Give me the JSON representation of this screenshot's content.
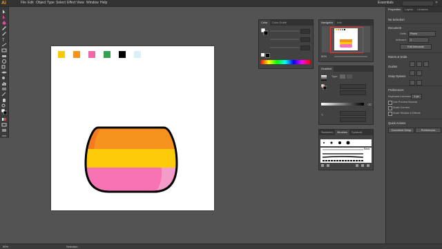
{
  "app": {
    "logo": "Ai"
  },
  "menu": [
    "File",
    "Edit",
    "Object",
    "Type",
    "Select",
    "Effect",
    "View",
    "Window",
    "Help"
  ],
  "workspace": {
    "label": "Essentials"
  },
  "swatches": [
    "#f9c90b",
    "#f6921e",
    "#ef67a8",
    "#33a150",
    "#000000",
    "#d7f1f7"
  ],
  "vase_colors": {
    "top": "#f6921e",
    "top_dark": "#f47b20",
    "middle": "#fecb0a",
    "bottom": "#f773b3",
    "bottom_light": "#f59bc9",
    "outline": "#000000"
  },
  "color_panel": {
    "tabs": [
      "Color",
      "Color Guide"
    ]
  },
  "navigator_panel": {
    "tabs": [
      "Navigator",
      "Info"
    ],
    "zoom": "50%"
  },
  "gradient_panel": {
    "tabs": [
      "Gradient"
    ],
    "type_label": "Type:"
  },
  "brushes_panel": {
    "tabs": [
      "Swatches",
      "Brushes",
      "Symbols"
    ],
    "brush_name": "Basic"
  },
  "properties": {
    "tabs": [
      "Properties",
      "Layers",
      "Libraries"
    ],
    "no_selection": "No Selection",
    "document": "Document",
    "units_label": "Units:",
    "units_value": "Pixels",
    "artboard_label": "Artboard:",
    "artboard_value": "1",
    "edit_artboards": "Edit Artboards",
    "rulers_grids": "Rulers & Grids",
    "guides": "Guides",
    "snap_options": "Snap Options",
    "preferences": "Preferences",
    "keyboard_increment": "Keyboard Increment:",
    "keyboard_increment_value": "1 px",
    "use_preview_bounds": "Use Preview Bounds",
    "scale_corners": "Scale Corners",
    "scale_strokes": "Scale Strokes & Effects",
    "quick_actions": "Quick Actions",
    "document_setup": "Document Setup",
    "preferences_btn": "Preferences"
  },
  "status": {
    "zoom": "50%",
    "tool": "Selection"
  }
}
